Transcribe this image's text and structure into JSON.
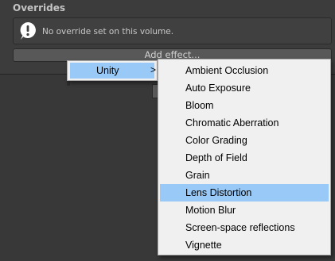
{
  "inspector": {
    "overrides_title": "Overrides",
    "help_message": "No override set on this volume.",
    "add_effect_label": "Add effect..."
  },
  "context_menu": {
    "root_items": [
      {
        "label": "Unity",
        "chevron": ">"
      }
    ],
    "submenu_items": [
      {
        "label": "Ambient Occlusion"
      },
      {
        "label": "Auto Exposure"
      },
      {
        "label": "Bloom"
      },
      {
        "label": "Chromatic Aberration"
      },
      {
        "label": "Color Grading"
      },
      {
        "label": "Depth of Field"
      },
      {
        "label": "Grain"
      },
      {
        "label": "Lens Distortion"
      },
      {
        "label": "Motion Blur"
      },
      {
        "label": "Screen-space reflections"
      },
      {
        "label": "Vignette"
      }
    ],
    "selected_item": "Lens Distortion"
  },
  "colors": {
    "highlight": "#99c9f7",
    "menu_background": "#f0f0f0",
    "editor_background": "#3c3c3c"
  },
  "icons": {
    "help_box": "info-icon",
    "submenu_arrow": "chevron-right-icon"
  }
}
